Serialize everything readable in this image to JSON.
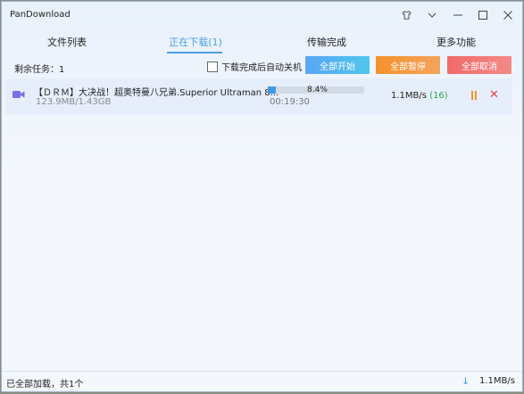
{
  "window": {
    "title": "PanDownload"
  },
  "titlebar_icons": [
    "shirt-icon",
    "chevron-down-icon",
    "minimize-icon",
    "maximize-icon",
    "close-icon"
  ],
  "tabs": [
    {
      "label": "文件列表",
      "active": false
    },
    {
      "label": "正在下载(1)",
      "active": true
    },
    {
      "label": "传输完成",
      "active": false
    },
    {
      "label": "更多功能",
      "active": false
    }
  ],
  "toolbar": {
    "remaining": "剩余任务：1",
    "auto_shutdown_label": "下载完成后自动关机",
    "auto_shutdown_checked": false,
    "start_all": "全部开始",
    "pause_all": "全部暂停",
    "cancel_all": "全部取消"
  },
  "tasks": [
    {
      "name": "【ＤＲＭ】大决战！超奥特曼八兄弟.Superior Ultraman 8...",
      "size": "123.9MB/1.43GB",
      "progress": 0.084,
      "progress_text": "8.4%",
      "elapsed": "00:19:30",
      "speed": "1.1MB/s",
      "connections": "(16)",
      "icon": "video-file-icon"
    }
  ],
  "status": {
    "text": "已全部加载，共1个",
    "total_speed": "1.1MB/s"
  },
  "colors": {
    "accent": "#4a9fe2",
    "start": "#5aa6f6",
    "pause": "#f5922a",
    "cancel": "#f26a6a",
    "file_icon": "#7b6ee8",
    "connections": "#2fa84a"
  }
}
